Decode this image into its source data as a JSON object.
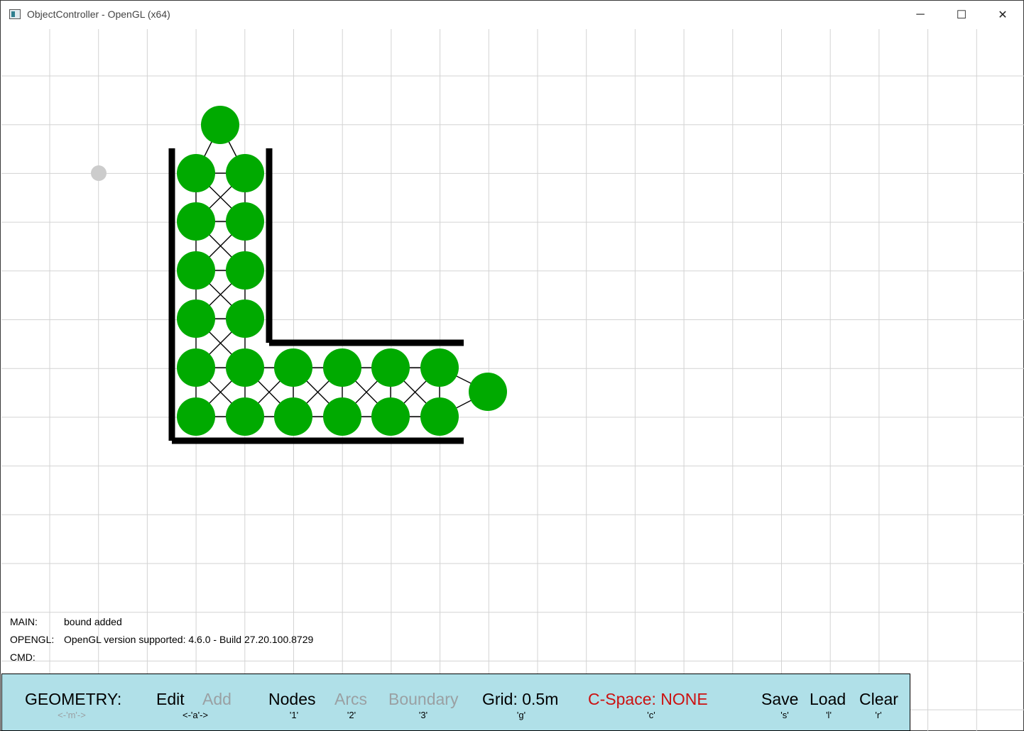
{
  "window": {
    "title": "ObjectController - OpenGL (x64)",
    "minimize_glyph": "─",
    "maximize_glyph": "☐",
    "close_glyph": "✕"
  },
  "status": {
    "main_label": "MAIN:",
    "main_value": "bound added",
    "opengl_label": "OPENGL:",
    "opengl_value": "OpenGL version supported: 4.6.0 - Build 27.20.100.8729",
    "cmd_label": "CMD:",
    "cmd_value": ""
  },
  "toolbar": {
    "mode_label": "GEOMETRY:",
    "mode_key": "<-'m'->",
    "edit_label": "Edit",
    "add_label": "Add",
    "edit_add_key": "<-'a'->",
    "nodes_label": "Nodes",
    "nodes_key": "'1'",
    "arcs_label": "Arcs",
    "arcs_key": "'2'",
    "boundary_label": "Boundary",
    "boundary_key": "'3'",
    "grid_label": "Grid: 0.5m",
    "grid_key": "'g'",
    "cspace_label": "C-Space: NONE",
    "cspace_key": "'c'",
    "save_label": "Save",
    "save_key": "'s'",
    "load_label": "Load",
    "load_key": "'l'",
    "clear_label": "Clear",
    "clear_key": "'r'"
  },
  "colors": {
    "node": "#00aa00",
    "boundary": "#000000",
    "grid_line": "#d3d3d3",
    "toolbar_bg": "#b0e0e8",
    "cursor_dot": "#cccccc",
    "active_text": "#000000",
    "inactive_text": "#9aa0a3",
    "cspace_text": "#cc1111"
  },
  "icons": {
    "app": "opengl-window-icon",
    "cursor": "cursor-dot-icon"
  }
}
